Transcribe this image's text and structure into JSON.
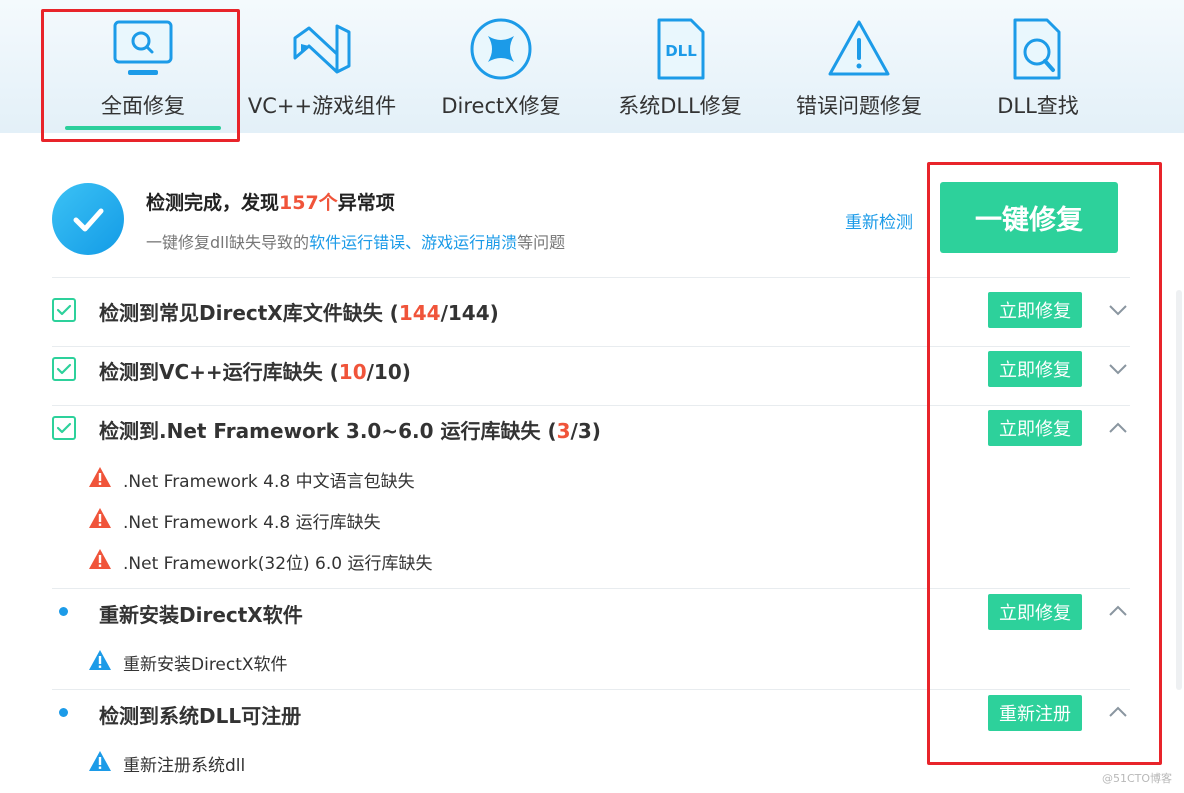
{
  "tabs": [
    {
      "label": "全面修复",
      "icon": "monitor-search-icon",
      "active": true
    },
    {
      "label": "VC++游戏组件",
      "icon": "visual-studio-icon",
      "active": false
    },
    {
      "label": "DirectX修复",
      "icon": "directx-icon",
      "active": false
    },
    {
      "label": "系统DLL修复",
      "icon": "dll-file-icon",
      "active": false
    },
    {
      "label": "错误问题修复",
      "icon": "warning-triangle-icon",
      "active": false
    },
    {
      "label": "DLL查找",
      "icon": "file-search-icon",
      "active": false
    }
  ],
  "status": {
    "title_prefix": "检测完成，发现",
    "count": "157个",
    "title_suffix": "异常项",
    "sub_prefix": "一键修复dll缺失导致的",
    "sub_highlight": "软件运行错误、游戏运行崩溃",
    "sub_suffix": "等问题",
    "recheck_label": "重新检测",
    "fix_all_label": "一键修复"
  },
  "items": [
    {
      "title_prefix": "检测到常见DirectX库文件缺失 (",
      "num": "144",
      "title_suffix": "/144)",
      "marker": "checkbox",
      "action": "立即修复",
      "expanded": false,
      "children": []
    },
    {
      "title_prefix": "检测到VC++运行库缺失 (",
      "num": "10",
      "title_suffix": "/10)",
      "marker": "checkbox",
      "action": "立即修复",
      "expanded": false,
      "children": []
    },
    {
      "title_prefix": "检测到.Net Framework 3.0~6.0 运行库缺失 (",
      "num": "3",
      "title_suffix": "/3)",
      "marker": "checkbox",
      "action": "立即修复",
      "expanded": true,
      "children": [
        ".Net Framework 4.8 中文语言包缺失",
        ".Net Framework 4.8 运行库缺失",
        ".Net Framework(32位) 6.0 运行库缺失"
      ]
    },
    {
      "title_prefix": "重新安装DirectX软件",
      "num": "",
      "title_suffix": "",
      "marker": "dot",
      "action": "立即修复",
      "expanded": true,
      "children": [
        "重新安装DirectX软件"
      ]
    },
    {
      "title_prefix": "检测到系统DLL可注册",
      "num": "",
      "title_suffix": "",
      "marker": "dot",
      "action": "重新注册",
      "expanded": true,
      "children": [
        "重新注册系统dll"
      ]
    }
  ],
  "watermark": "@51CTO博客",
  "colors": {
    "accent_green": "#2dd19b",
    "accent_blue": "#1c9be8",
    "alert_red": "#f0543a",
    "annotation_red": "#e8242a"
  }
}
